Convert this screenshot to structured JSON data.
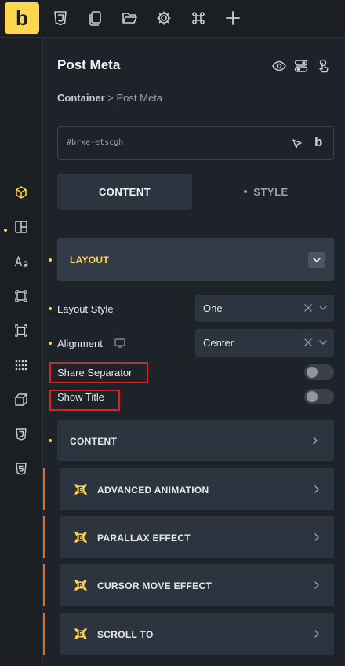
{
  "topbar": {
    "logo_letter": "b",
    "icons": [
      "css3-icon",
      "copy-icon",
      "folder-open-icon",
      "gear-icon",
      "command-icon",
      "plus-icon"
    ]
  },
  "leftbar": {
    "icons": [
      "cube-icon",
      "layout-icon",
      "typography-icon",
      "box-icon",
      "frame-icon",
      "grid-dots-icon",
      "transform-icon",
      "css3-icon",
      "html5-icon"
    ],
    "active": "cube-icon"
  },
  "panel": {
    "title": "Post Meta",
    "breadcrumb_parent": "Container",
    "breadcrumb_sep": ">",
    "breadcrumb_current": "Post Meta",
    "element_id": "#brxe-etscgh",
    "id_logo": "b"
  },
  "tabs": {
    "content": "CONTENT",
    "style": "STYLE"
  },
  "layout_section": {
    "label": "LAYOUT"
  },
  "controls": {
    "layout_style": {
      "label": "Layout Style",
      "value": "One"
    },
    "alignment": {
      "label": "Alignment",
      "value": "Center"
    },
    "share_separator": {
      "label": "Share Separator",
      "on": false
    },
    "show_title": {
      "label": "Show Title",
      "on": false
    }
  },
  "content_section": {
    "label": "CONTENT"
  },
  "addons": [
    {
      "label": "ADVANCED ANIMATION"
    },
    {
      "label": "PARALLAX EFFECT"
    },
    {
      "label": "CURSOR MOVE EFFECT"
    },
    {
      "label": "SCROLL TO"
    }
  ],
  "colors": {
    "accent": "#ffd64f",
    "background": "#1e2329",
    "section": "#2c3440",
    "highlight_box": "#e0201e",
    "addon_bar": "#e26a1f"
  }
}
